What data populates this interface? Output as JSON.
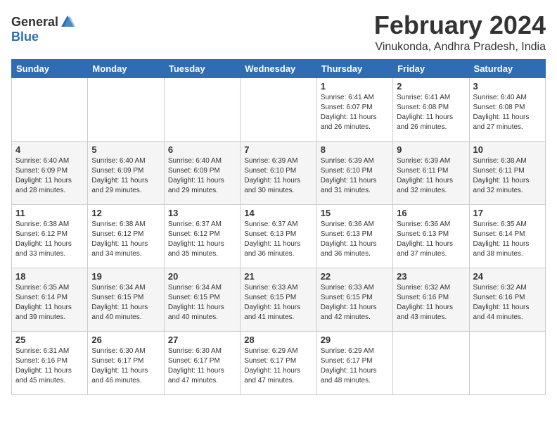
{
  "header": {
    "logo_general": "General",
    "logo_blue": "Blue",
    "month_title": "February 2024",
    "location": "Vinukonda, Andhra Pradesh, India"
  },
  "days_of_week": [
    "Sunday",
    "Monday",
    "Tuesday",
    "Wednesday",
    "Thursday",
    "Friday",
    "Saturday"
  ],
  "weeks": [
    [
      {
        "day": "",
        "info": ""
      },
      {
        "day": "",
        "info": ""
      },
      {
        "day": "",
        "info": ""
      },
      {
        "day": "",
        "info": ""
      },
      {
        "day": "1",
        "info": "Sunrise: 6:41 AM\nSunset: 6:07 PM\nDaylight: 11 hours\nand 26 minutes."
      },
      {
        "day": "2",
        "info": "Sunrise: 6:41 AM\nSunset: 6:08 PM\nDaylight: 11 hours\nand 26 minutes."
      },
      {
        "day": "3",
        "info": "Sunrise: 6:40 AM\nSunset: 6:08 PM\nDaylight: 11 hours\nand 27 minutes."
      }
    ],
    [
      {
        "day": "4",
        "info": "Sunrise: 6:40 AM\nSunset: 6:09 PM\nDaylight: 11 hours\nand 28 minutes."
      },
      {
        "day": "5",
        "info": "Sunrise: 6:40 AM\nSunset: 6:09 PM\nDaylight: 11 hours\nand 29 minutes."
      },
      {
        "day": "6",
        "info": "Sunrise: 6:40 AM\nSunset: 6:09 PM\nDaylight: 11 hours\nand 29 minutes."
      },
      {
        "day": "7",
        "info": "Sunrise: 6:39 AM\nSunset: 6:10 PM\nDaylight: 11 hours\nand 30 minutes."
      },
      {
        "day": "8",
        "info": "Sunrise: 6:39 AM\nSunset: 6:10 PM\nDaylight: 11 hours\nand 31 minutes."
      },
      {
        "day": "9",
        "info": "Sunrise: 6:39 AM\nSunset: 6:11 PM\nDaylight: 11 hours\nand 32 minutes."
      },
      {
        "day": "10",
        "info": "Sunrise: 6:38 AM\nSunset: 6:11 PM\nDaylight: 11 hours\nand 32 minutes."
      }
    ],
    [
      {
        "day": "11",
        "info": "Sunrise: 6:38 AM\nSunset: 6:12 PM\nDaylight: 11 hours\nand 33 minutes."
      },
      {
        "day": "12",
        "info": "Sunrise: 6:38 AM\nSunset: 6:12 PM\nDaylight: 11 hours\nand 34 minutes."
      },
      {
        "day": "13",
        "info": "Sunrise: 6:37 AM\nSunset: 6:12 PM\nDaylight: 11 hours\nand 35 minutes."
      },
      {
        "day": "14",
        "info": "Sunrise: 6:37 AM\nSunset: 6:13 PM\nDaylight: 11 hours\nand 36 minutes."
      },
      {
        "day": "15",
        "info": "Sunrise: 6:36 AM\nSunset: 6:13 PM\nDaylight: 11 hours\nand 36 minutes."
      },
      {
        "day": "16",
        "info": "Sunrise: 6:36 AM\nSunset: 6:13 PM\nDaylight: 11 hours\nand 37 minutes."
      },
      {
        "day": "17",
        "info": "Sunrise: 6:35 AM\nSunset: 6:14 PM\nDaylight: 11 hours\nand 38 minutes."
      }
    ],
    [
      {
        "day": "18",
        "info": "Sunrise: 6:35 AM\nSunset: 6:14 PM\nDaylight: 11 hours\nand 39 minutes."
      },
      {
        "day": "19",
        "info": "Sunrise: 6:34 AM\nSunset: 6:15 PM\nDaylight: 11 hours\nand 40 minutes."
      },
      {
        "day": "20",
        "info": "Sunrise: 6:34 AM\nSunset: 6:15 PM\nDaylight: 11 hours\nand 40 minutes."
      },
      {
        "day": "21",
        "info": "Sunrise: 6:33 AM\nSunset: 6:15 PM\nDaylight: 11 hours\nand 41 minutes."
      },
      {
        "day": "22",
        "info": "Sunrise: 6:33 AM\nSunset: 6:15 PM\nDaylight: 11 hours\nand 42 minutes."
      },
      {
        "day": "23",
        "info": "Sunrise: 6:32 AM\nSunset: 6:16 PM\nDaylight: 11 hours\nand 43 minutes."
      },
      {
        "day": "24",
        "info": "Sunrise: 6:32 AM\nSunset: 6:16 PM\nDaylight: 11 hours\nand 44 minutes."
      }
    ],
    [
      {
        "day": "25",
        "info": "Sunrise: 6:31 AM\nSunset: 6:16 PM\nDaylight: 11 hours\nand 45 minutes."
      },
      {
        "day": "26",
        "info": "Sunrise: 6:30 AM\nSunset: 6:17 PM\nDaylight: 11 hours\nand 46 minutes."
      },
      {
        "day": "27",
        "info": "Sunrise: 6:30 AM\nSunset: 6:17 PM\nDaylight: 11 hours\nand 47 minutes."
      },
      {
        "day": "28",
        "info": "Sunrise: 6:29 AM\nSunset: 6:17 PM\nDaylight: 11 hours\nand 47 minutes."
      },
      {
        "day": "29",
        "info": "Sunrise: 6:29 AM\nSunset: 6:17 PM\nDaylight: 11 hours\nand 48 minutes."
      },
      {
        "day": "",
        "info": ""
      },
      {
        "day": "",
        "info": ""
      }
    ]
  ]
}
